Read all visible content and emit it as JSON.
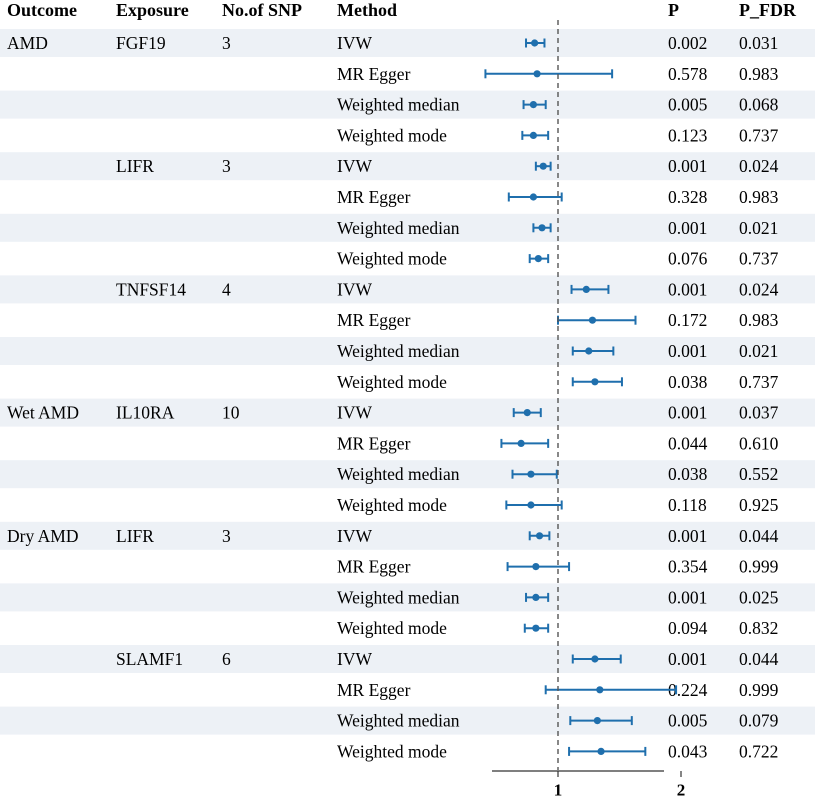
{
  "chart_data": {
    "type": "forest",
    "columns": [
      "Outcome",
      "Exposure",
      "No.of SNP",
      "Method",
      "P",
      "P_FDR"
    ],
    "x_ticks": [
      "1",
      "2"
    ],
    "reference_value": 1,
    "xlim": [
      0.4,
      2.0
    ],
    "colors": {
      "marker": "#1f6fad",
      "stripe": "#edf1f6",
      "reference": "#555555"
    },
    "rows": [
      {
        "outcome": "AMD",
        "exposure": "FGF19",
        "nsnp": "3",
        "method": "IVW",
        "p": "0.002",
        "p_fdr": "0.031",
        "or": 0.81,
        "lo": 0.74,
        "hi": 0.89
      },
      {
        "outcome": "",
        "exposure": "",
        "nsnp": "",
        "method": "MR Egger",
        "p": "0.578",
        "p_fdr": "0.983",
        "or": 0.83,
        "lo": 0.41,
        "hi": 1.44
      },
      {
        "outcome": "",
        "exposure": "",
        "nsnp": "",
        "method": "Weighted median",
        "p": "0.005",
        "p_fdr": "0.068",
        "or": 0.8,
        "lo": 0.72,
        "hi": 0.9
      },
      {
        "outcome": "",
        "exposure": "",
        "nsnp": "",
        "method": "Weighted mode",
        "p": "0.123",
        "p_fdr": "0.737",
        "or": 0.8,
        "lo": 0.71,
        "hi": 0.92
      },
      {
        "outcome": "",
        "exposure": "LIFR",
        "nsnp": "3",
        "method": "IVW",
        "p": "0.001",
        "p_fdr": "0.024",
        "or": 0.88,
        "lo": 0.82,
        "hi": 0.94
      },
      {
        "outcome": "",
        "exposure": "",
        "nsnp": "",
        "method": "MR Egger",
        "p": "0.328",
        "p_fdr": "0.983",
        "or": 0.8,
        "lo": 0.6,
        "hi": 1.03
      },
      {
        "outcome": "",
        "exposure": "",
        "nsnp": "",
        "method": "Weighted median",
        "p": "0.001",
        "p_fdr": "0.021",
        "or": 0.87,
        "lo": 0.8,
        "hi": 0.94
      },
      {
        "outcome": "",
        "exposure": "",
        "nsnp": "",
        "method": "Weighted mode",
        "p": "0.076",
        "p_fdr": "0.737",
        "or": 0.84,
        "lo": 0.77,
        "hi": 0.92
      },
      {
        "outcome": "",
        "exposure": "TNFSF14",
        "nsnp": "4",
        "method": "IVW",
        "p": "0.001",
        "p_fdr": "0.024",
        "or": 1.23,
        "lo": 1.11,
        "hi": 1.41
      },
      {
        "outcome": "",
        "exposure": "",
        "nsnp": "",
        "method": "MR Egger",
        "p": "0.172",
        "p_fdr": "0.983",
        "or": 1.28,
        "lo": 1.0,
        "hi": 1.63
      },
      {
        "outcome": "",
        "exposure": "",
        "nsnp": "",
        "method": "Weighted median",
        "p": "0.001",
        "p_fdr": "0.021",
        "or": 1.25,
        "lo": 1.12,
        "hi": 1.45
      },
      {
        "outcome": "",
        "exposure": "",
        "nsnp": "",
        "method": "Weighted mode",
        "p": "0.038",
        "p_fdr": "0.737",
        "or": 1.3,
        "lo": 1.12,
        "hi": 1.52
      },
      {
        "outcome": "Wet AMD",
        "exposure": "IL10RA",
        "nsnp": "10",
        "method": "IVW",
        "p": "0.001",
        "p_fdr": "0.037",
        "or": 0.75,
        "lo": 0.64,
        "hi": 0.86
      },
      {
        "outcome": "",
        "exposure": "",
        "nsnp": "",
        "method": "MR Egger",
        "p": "0.044",
        "p_fdr": "0.610",
        "or": 0.7,
        "lo": 0.54,
        "hi": 0.92
      },
      {
        "outcome": "",
        "exposure": "",
        "nsnp": "",
        "method": "Weighted median",
        "p": "0.038",
        "p_fdr": "0.552",
        "or": 0.78,
        "lo": 0.63,
        "hi": 0.99
      },
      {
        "outcome": "",
        "exposure": "",
        "nsnp": "",
        "method": "Weighted mode",
        "p": "0.118",
        "p_fdr": "0.925",
        "or": 0.78,
        "lo": 0.58,
        "hi": 1.03
      },
      {
        "outcome": "Dry AMD",
        "exposure": "LIFR",
        "nsnp": "3",
        "method": "IVW",
        "p": "0.001",
        "p_fdr": "0.044",
        "or": 0.85,
        "lo": 0.77,
        "hi": 0.93
      },
      {
        "outcome": "",
        "exposure": "",
        "nsnp": "",
        "method": "MR Egger",
        "p": "0.354",
        "p_fdr": "0.999",
        "or": 0.82,
        "lo": 0.59,
        "hi": 1.09
      },
      {
        "outcome": "",
        "exposure": "",
        "nsnp": "",
        "method": "Weighted median",
        "p": "0.001",
        "p_fdr": "0.025",
        "or": 0.82,
        "lo": 0.74,
        "hi": 0.92
      },
      {
        "outcome": "",
        "exposure": "",
        "nsnp": "",
        "method": "Weighted mode",
        "p": "0.094",
        "p_fdr": "0.832",
        "or": 0.82,
        "lo": 0.73,
        "hi": 0.92
      },
      {
        "outcome": "",
        "exposure": "SLAMF1",
        "nsnp": "6",
        "method": "IVW",
        "p": "0.001",
        "p_fdr": "0.044",
        "or": 1.3,
        "lo": 1.12,
        "hi": 1.51
      },
      {
        "outcome": "",
        "exposure": "",
        "nsnp": "",
        "method": "MR Egger",
        "p": "0.224",
        "p_fdr": "0.999",
        "or": 1.34,
        "lo": 0.9,
        "hi": 1.96
      },
      {
        "outcome": "",
        "exposure": "",
        "nsnp": "",
        "method": "Weighted median",
        "p": "0.005",
        "p_fdr": "0.079",
        "or": 1.32,
        "lo": 1.1,
        "hi": 1.6
      },
      {
        "outcome": "",
        "exposure": "",
        "nsnp": "",
        "method": "Weighted mode",
        "p": "0.043",
        "p_fdr": "0.722",
        "or": 1.35,
        "lo": 1.09,
        "hi": 1.71
      }
    ]
  }
}
